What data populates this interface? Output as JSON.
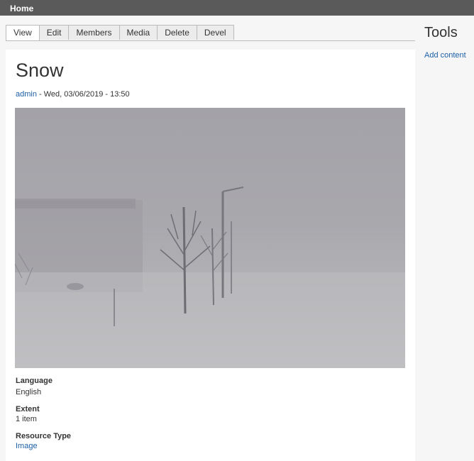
{
  "topbar": {
    "home_label": "Home"
  },
  "tabs": [
    {
      "label": "View",
      "active": true
    },
    {
      "label": "Edit"
    },
    {
      "label": "Members"
    },
    {
      "label": "Media"
    },
    {
      "label": "Delete"
    },
    {
      "label": "Devel"
    }
  ],
  "node": {
    "title": "Snow",
    "author": "admin",
    "date_text": " - Wed, 03/06/2019 - 13:50",
    "image_icon": "snowstorm-photo",
    "fields": [
      {
        "label": "Language",
        "value": "English"
      },
      {
        "label": "Extent",
        "value": "1 item"
      },
      {
        "label": "Resource Type",
        "value": "Image"
      }
    ]
  },
  "sidebar": {
    "title": "Tools",
    "links": [
      {
        "label": "Add content"
      }
    ]
  }
}
